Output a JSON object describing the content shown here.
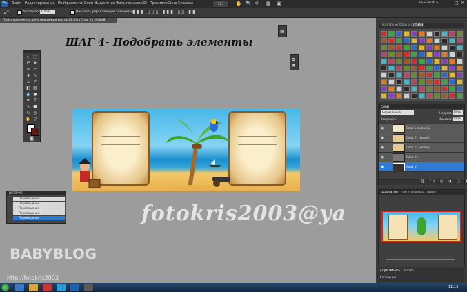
{
  "app": {
    "title": "Adobe Photoshop CS4"
  },
  "menubar": {
    "items": [
      "Файл",
      "Редактирование",
      "Изображение",
      "Слой",
      "Выделение",
      "Фильтр",
      "Анализ",
      "3D",
      "Просмотр",
      "Окно",
      "Справка"
    ],
    "workspace": "ESSENTIALS"
  },
  "options": {
    "autoselect_label": "Автовыбор:",
    "autoselect_value": "Слой",
    "transform_label": "Показать управляющие элементы"
  },
  "document": {
    "tab_title": "Приглашение на день рождения.psd @ 33,3% (Слой 21, RGB/8) *"
  },
  "canvas": {
    "title": "ШАГ 4- Подобрать элементы",
    "watermark": "fotokris2003@ya",
    "logo": "BABYBLOG",
    "url": "http://fotokris2003"
  },
  "mini_layers": {
    "title": "ИСТОРИЯ",
    "rows": [
      "Перемещение",
      "Перемещение",
      "Перемещение",
      "Перемещение",
      "Перемещение"
    ]
  },
  "right_panels": {
    "swatch_tabs": [
      "ОБРАЗЕЦ",
      "КОРРЕКЦИЯ",
      "СТИЛИ"
    ],
    "layers_tab": "СЛОИ",
    "blend_mode": "Нормальный",
    "opacity_label": "Непрозр.:",
    "opacity_value": "100%",
    "lock_label": "Закрепить:",
    "fill_label": "Заливка:",
    "fill_value": "100%",
    "layers": [
      {
        "name": "Слой 1 (копия) 2"
      },
      {
        "name": "Слой 21 (копия)"
      },
      {
        "name": "Слой 22 (копия)"
      },
      {
        "name": "Слой 22"
      },
      {
        "name": "Слой 21"
      }
    ],
    "navigator_tabs": [
      "НАВИГАТОР",
      "ГИСТОГРАММА",
      "ИНФО"
    ],
    "bottom_tabs": [
      "ADJUSTMENTS",
      "MASKS"
    ],
    "bottom_text": "Коррекция"
  },
  "taskbar": {
    "clock": "11:15"
  },
  "colors": {
    "menubar": "#2c2c2c",
    "panel": "#3a3a3a",
    "canvas_bg": "#9c9c9c",
    "selection": "#2e7bd6"
  }
}
